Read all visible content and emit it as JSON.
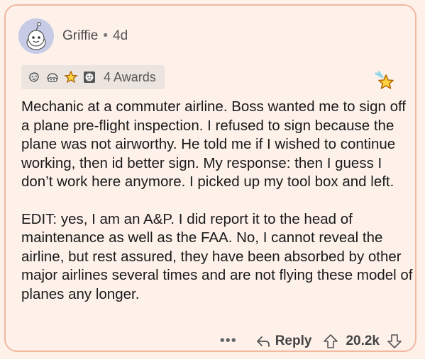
{
  "comment": {
    "author": "Griffie",
    "separator": "•",
    "age": "4d",
    "awards_label": "4 Awards",
    "award_icons": [
      "face-award-icon",
      "helmet-award-icon",
      "star-award-icon",
      "ape-award-icon"
    ],
    "paragraphs": [
      "Mechanic at a commuter airline. Boss wanted me to sign off a plane pre-flight inspection. I refused to sign because the plane was not airworthy. He told me if I wished to continue working, then id better sign. My response: then I guess I don’t work here anymore. I picked up my tool box and left.",
      "EDIT: yes, I am an A&P. I did report it to the head of maintenance as well as the FAA. No, I cannot reveal the airline, but rest assured, they have been absorbed by other major airlines several times and are not flying these model of planes any longer."
    ],
    "actions": {
      "more_label": "•••",
      "reply_label": "Reply",
      "vote_count": "20.2k"
    }
  },
  "colors": {
    "background": "#fdf1ea",
    "border": "#f2b8a0",
    "awards_bg": "#ece4df",
    "avatar_bg": "#c7cbe6"
  }
}
